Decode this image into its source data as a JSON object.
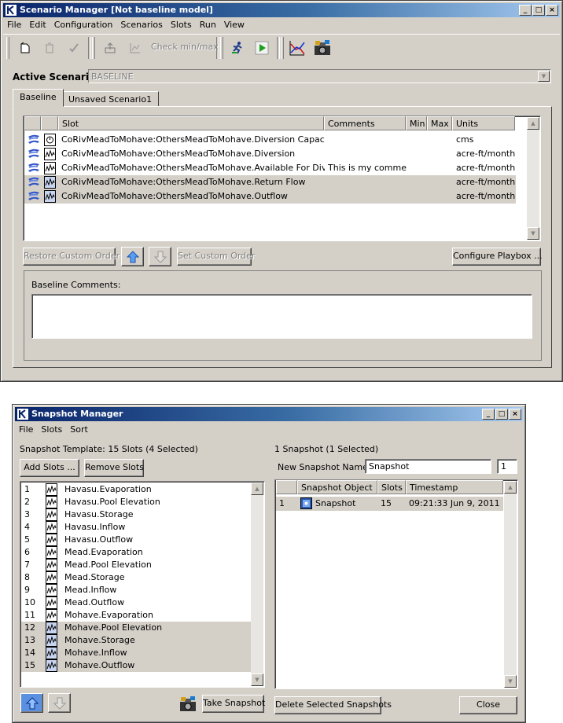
{
  "scenario_manager": {
    "title": "Scenario Manager [Not baseline model]",
    "menu": [
      "File",
      "Edit",
      "Configuration",
      "Scenarios",
      "Slots",
      "Run",
      "View"
    ],
    "toolbar": {
      "check_minmax_label": "Check min/max"
    },
    "active_scenario_label": "Active Scenario:",
    "active_scenario_value": "BASELINE",
    "tabs": [
      "Baseline",
      "Unsaved Scenario1"
    ],
    "columns": [
      "Slot",
      "Comments",
      "Min",
      "Max",
      "Units"
    ],
    "rows": [
      {
        "slot": "CoRivMeadToMohave:OthersMeadToMohave.Diversion Capacity",
        "comments": "",
        "min": "",
        "max": "",
        "units": "cms",
        "icon": "scalar-slot-icon",
        "selected": false
      },
      {
        "slot": "CoRivMeadToMohave:OthersMeadToMohave.Diversion",
        "comments": "",
        "min": "",
        "max": "",
        "units": "acre-ft/month",
        "icon": "series-slot-icon",
        "selected": false
      },
      {
        "slot": "CoRivMeadToMohave:OthersMeadToMohave.Available For Diversion",
        "comments": "This is my comment",
        "min": "",
        "max": "",
        "units": "acre-ft/month",
        "icon": "series-slot-icon",
        "selected": false
      },
      {
        "slot": "CoRivMeadToMohave:OthersMeadToMohave.Return Flow",
        "comments": "",
        "min": "",
        "max": "",
        "units": "acre-ft/month",
        "icon": "series-slot-icon",
        "selected": true
      },
      {
        "slot": "CoRivMeadToMohave:OthersMeadToMohave.Outflow",
        "comments": "",
        "min": "",
        "max": "",
        "units": "acre-ft/month",
        "icon": "series-slot-icon",
        "selected": true
      }
    ],
    "buttons": {
      "restore_custom_order": "Restore Custom Order",
      "set_custom_order": "Set Custom Order",
      "configure_playbox": "Configure Playbox ..."
    },
    "baseline_comments_label": "Baseline Comments:",
    "baseline_comments_value": ""
  },
  "snapshot_manager": {
    "title": "Snapshot Manager",
    "menu": [
      "File",
      "Slots",
      "Sort"
    ],
    "template_label": "Snapshot Template: 15 Slots (4 Selected)",
    "add_slots": "Add Slots ...",
    "remove_slots": "Remove Slots",
    "slots": [
      {
        "n": "1",
        "name": "Havasu.Evaporation",
        "selected": false
      },
      {
        "n": "2",
        "name": "Havasu.Pool Elevation",
        "selected": false
      },
      {
        "n": "3",
        "name": "Havasu.Storage",
        "selected": false
      },
      {
        "n": "4",
        "name": "Havasu.Inflow",
        "selected": false
      },
      {
        "n": "5",
        "name": "Havasu.Outflow",
        "selected": false
      },
      {
        "n": "6",
        "name": "Mead.Evaporation",
        "selected": false
      },
      {
        "n": "7",
        "name": "Mead.Pool Elevation",
        "selected": false
      },
      {
        "n": "8",
        "name": "Mead.Storage",
        "selected": false
      },
      {
        "n": "9",
        "name": "Mead.Inflow",
        "selected": false
      },
      {
        "n": "10",
        "name": "Mead.Outflow",
        "selected": false
      },
      {
        "n": "11",
        "name": "Mohave.Evaporation",
        "selected": false
      },
      {
        "n": "12",
        "name": "Mohave.Pool Elevation",
        "selected": true
      },
      {
        "n": "13",
        "name": "Mohave.Storage",
        "selected": true
      },
      {
        "n": "14",
        "name": "Mohave.Inflow",
        "selected": true
      },
      {
        "n": "15",
        "name": "Mohave.Outflow",
        "selected": true
      }
    ],
    "take_snapshot": "Take Snapshot",
    "snapshot_count_label": "1 Snapshot (1 Selected)",
    "new_name_label": "New Snapshot Name:",
    "new_name_value": "Snapshot",
    "new_name_index": "1",
    "columns": [
      "Snapshot Object",
      "Slots",
      "Timestamp"
    ],
    "snapshots": [
      {
        "n": "1",
        "object": "Snapshot",
        "slots": "15",
        "timestamp": "09:21:33 Jun 9, 2011",
        "selected": true
      }
    ],
    "delete_selected": "Delete Selected Snapshots",
    "close": "Close"
  },
  "colors": {
    "window_bg": "#d4d0c8",
    "titlebar_start": "#0a246a",
    "titlebar_end": "#a6caf0",
    "selection_bg": "#d4d0c8",
    "accent_blue": "#3355cc"
  }
}
